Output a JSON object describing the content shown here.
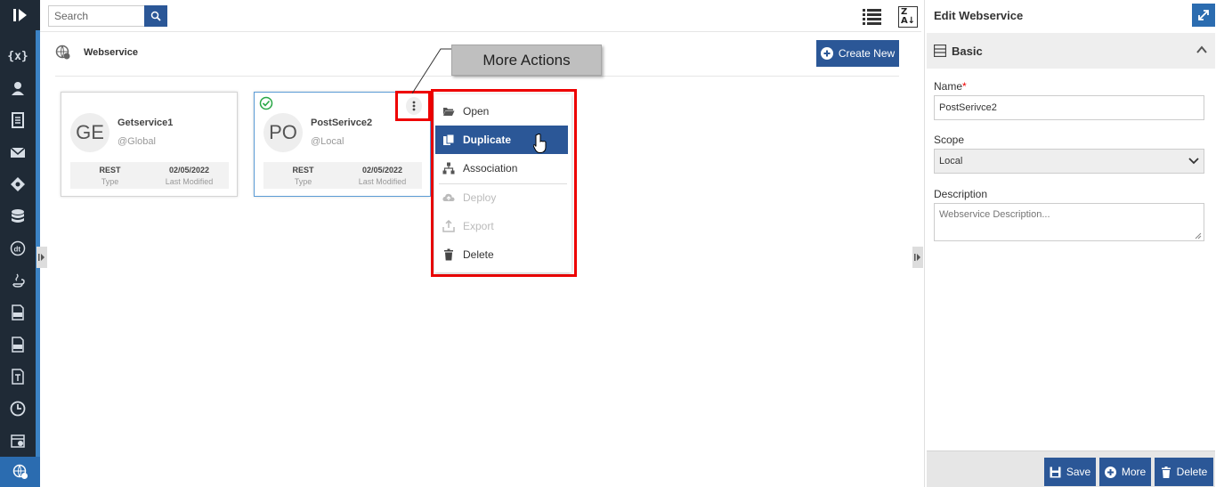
{
  "search": {
    "placeholder": "Search"
  },
  "page": {
    "title": "Webservice",
    "create_label": "Create New"
  },
  "cards": [
    {
      "initials": "GE",
      "name": "Getservice1",
      "scope": "@Global",
      "type": "REST",
      "type_label": "Type",
      "modified": "02/05/2022",
      "modified_label": "Last Modified"
    },
    {
      "initials": "PO",
      "name": "PostSerivce2",
      "scope": "@Local",
      "type": "REST",
      "type_label": "Type",
      "modified": "02/05/2022",
      "modified_label": "Last Modified"
    }
  ],
  "callout": {
    "text": "More Actions"
  },
  "menu": {
    "items": [
      {
        "label": "Open",
        "icon": "folder-open-icon",
        "state": "normal"
      },
      {
        "label": "Duplicate",
        "icon": "copy-icon",
        "state": "hover"
      },
      {
        "label": "Association",
        "icon": "sitemap-icon",
        "state": "normal"
      },
      {
        "label": "Deploy",
        "icon": "cloud-upload-icon",
        "state": "disabled"
      },
      {
        "label": "Export",
        "icon": "export-icon",
        "state": "disabled"
      },
      {
        "label": "Delete",
        "icon": "trash-icon",
        "state": "normal"
      }
    ]
  },
  "panel": {
    "title": "Edit Webservice",
    "section": "Basic",
    "name_label": "Name",
    "required_mark": "*",
    "name_value": "PostSerivce2",
    "scope_label": "Scope",
    "scope_value": "Local",
    "description_label": "Description",
    "description_placeholder": "Webservice Description...",
    "buttons": {
      "save": "Save",
      "more": "More",
      "delete": "Delete"
    }
  },
  "colors": {
    "rail": "#1f2a36",
    "primary": "#2b5797",
    "highlight": "#e00000",
    "success": "#28a745"
  }
}
